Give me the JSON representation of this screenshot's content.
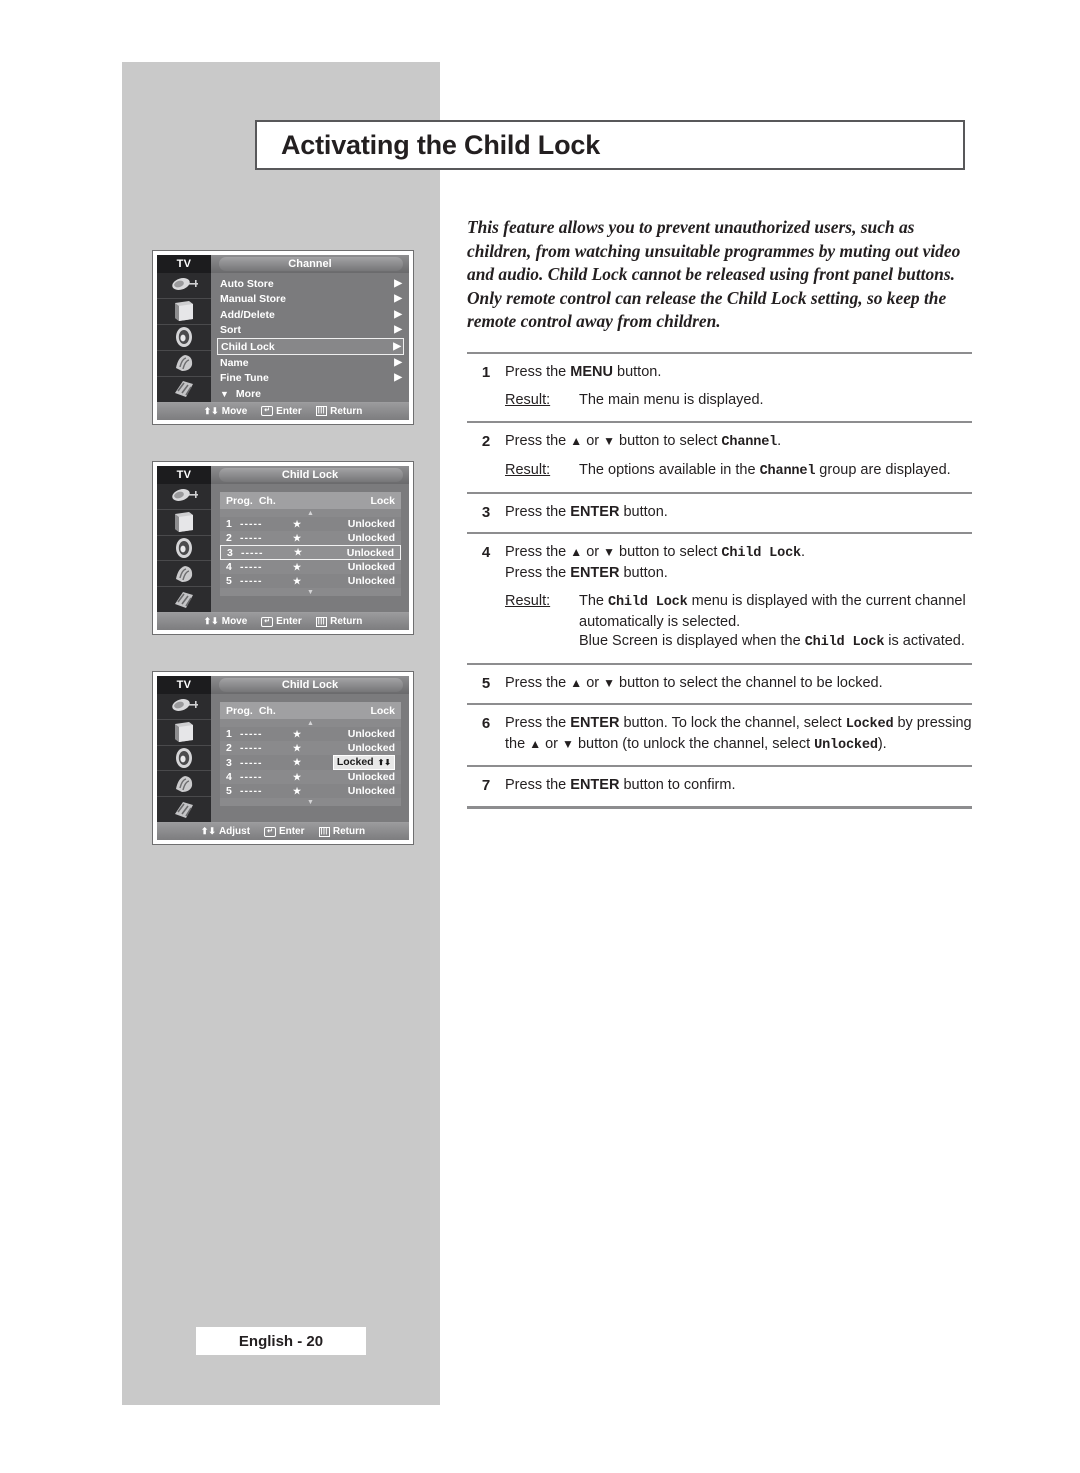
{
  "page": {
    "title": "Activating the Child Lock",
    "footer": "English - 20"
  },
  "intro": "This feature allows you to prevent unauthorized users, such as children, from watching unsuitable programmes by muting out video and audio. Child Lock cannot be released using front panel buttons. Only remote control can release the Child Lock setting, so keep the remote control away from children.",
  "result_label": "Result:",
  "steps": [
    {
      "num": "1",
      "lines": [
        "Press the MENU button."
      ],
      "bold_terms": [
        "MENU"
      ],
      "result": "The main menu is displayed."
    },
    {
      "num": "2",
      "lines": [
        "Press the ▲ or ▼ button to select Channel."
      ],
      "mono_terms": [
        "Channel"
      ],
      "result": "The options available in the Channel group are displayed."
    },
    {
      "num": "3",
      "lines": [
        "Press the ENTER button."
      ],
      "bold_terms": [
        "ENTER"
      ],
      "result": ""
    },
    {
      "num": "4",
      "lines": [
        "Press the ▲ or ▼ button to select Child Lock.",
        "Press the ENTER button."
      ],
      "mono_terms": [
        "Child Lock"
      ],
      "bold_terms": [
        "ENTER"
      ],
      "result": "The Child Lock menu is displayed with the current channel automatically is selected. Blue Screen is displayed when the Child Lock is activated."
    },
    {
      "num": "5",
      "lines": [
        "Press the ▲ or ▼ button to select the channel to be locked."
      ],
      "result": ""
    },
    {
      "num": "6",
      "lines": [
        "Press the ENTER button. To lock the channel, select Locked by pressing the ▲ or ▼ button (to unlock the channel, select Unlocked)."
      ],
      "bold_terms": [
        "ENTER"
      ],
      "mono_terms": [
        "Locked",
        "Unlocked"
      ],
      "result": ""
    },
    {
      "num": "7",
      "lines": [
        "Press the ENTER button to confirm."
      ],
      "bold_terms": [
        "ENTER"
      ],
      "result": ""
    }
  ],
  "osd": {
    "tv_label": "TV",
    "sidebar_icons": [
      "antenna-icon",
      "tv-set-icon",
      "speaker-icon",
      "feature-icon",
      "setup-icon"
    ],
    "panel1": {
      "title": "Channel",
      "items": [
        {
          "label": "Auto Store",
          "arrow": "▶",
          "selected": false
        },
        {
          "label": "Manual Store",
          "arrow": "▶",
          "selected": false
        },
        {
          "label": "Add/Delete",
          "arrow": "▶",
          "selected": false
        },
        {
          "label": "Sort",
          "arrow": "▶",
          "selected": false
        },
        {
          "label": "Child Lock",
          "arrow": "▶",
          "selected": true
        },
        {
          "label": "Name",
          "arrow": "▶",
          "selected": false
        },
        {
          "label": "Fine Tune",
          "arrow": "▶",
          "selected": false
        }
      ],
      "more_label": "More",
      "footer": {
        "move": "Move",
        "enter": "Enter",
        "return": "Return"
      }
    },
    "panel2": {
      "title": "Child Lock",
      "headers": {
        "prog": "Prog.",
        "ch": "Ch.",
        "lock": "Lock"
      },
      "rows": [
        {
          "prog": "1",
          "ch": "-----",
          "star": "★",
          "lock": "Unlocked",
          "selected": false
        },
        {
          "prog": "2",
          "ch": "-----",
          "star": "★",
          "lock": "Unlocked",
          "selected": false
        },
        {
          "prog": "3",
          "ch": "-----",
          "star": "★",
          "lock": "Unlocked",
          "selected": true
        },
        {
          "prog": "4",
          "ch": "-----",
          "star": "★",
          "lock": "Unlocked",
          "selected": false
        },
        {
          "prog": "5",
          "ch": "-----",
          "star": "★",
          "lock": "Unlocked",
          "selected": false
        }
      ],
      "footer": {
        "move": "Move",
        "enter": "Enter",
        "return": "Return"
      }
    },
    "panel3": {
      "title": "Child Lock",
      "headers": {
        "prog": "Prog.",
        "ch": "Ch.",
        "lock": "Lock"
      },
      "rows": [
        {
          "prog": "1",
          "ch": "-----",
          "star": "★",
          "lock": "Unlocked",
          "chip": false
        },
        {
          "prog": "2",
          "ch": "-----",
          "star": "★",
          "lock": "Unlocked",
          "chip": false
        },
        {
          "prog": "3",
          "ch": "-----",
          "star": "★",
          "lock": "Locked",
          "chip": true
        },
        {
          "prog": "4",
          "ch": "-----",
          "star": "★",
          "lock": "Unlocked",
          "chip": false
        },
        {
          "prog": "5",
          "ch": "-----",
          "star": "★",
          "lock": "Unlocked",
          "chip": false
        }
      ],
      "footer": {
        "move": "Adjust",
        "enter": "Enter",
        "return": "Return"
      }
    }
  },
  "colors": {
    "band": "#c9c9c9",
    "ink": "#231f20",
    "rule": "#8d8d8f",
    "osd_bg": "#7b7b7d",
    "osd_sidebar": "#2c2c2e"
  }
}
